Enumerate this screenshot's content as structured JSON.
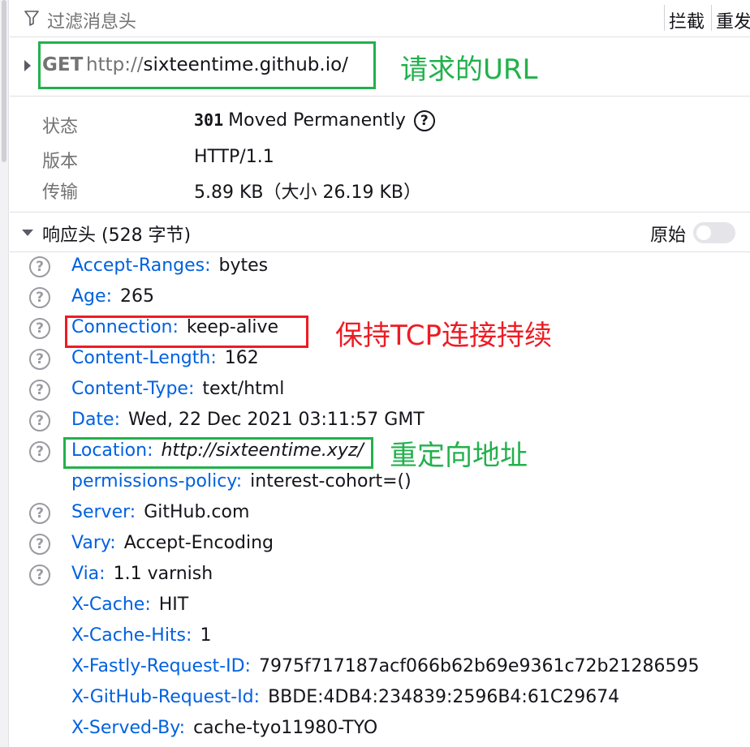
{
  "filter_bar": {
    "placeholder": "过滤消息头",
    "block_label": "拦截",
    "resend_label": "重发"
  },
  "request": {
    "method": "GET",
    "url_scheme": "http://",
    "url_rest": "sixteentime.github.io/"
  },
  "status": {
    "status_label": "状态",
    "status_code": "301",
    "status_text": "Moved Permanently",
    "version_label": "版本",
    "version_value": "HTTP/1.1",
    "transfer_label": "传输",
    "transfer_value": "5.89 KB（大小 26.19 KB）"
  },
  "response_headers": {
    "title": "响应头 (528 字节)",
    "raw_label": "原始",
    "raw_toggle_on": false,
    "help_glyph": "?",
    "rows": [
      {
        "name": "Accept-Ranges",
        "value": "bytes",
        "help": true
      },
      {
        "name": "Age",
        "value": "265",
        "help": true
      },
      {
        "name": "Connection",
        "value": "keep-alive",
        "help": true
      },
      {
        "name": "Content-Length",
        "value": "162",
        "help": true
      },
      {
        "name": "Content-Type",
        "value": "text/html",
        "help": true
      },
      {
        "name": "Date",
        "value": "Wed, 22 Dec 2021 03:11:57 GMT",
        "help": true
      },
      {
        "name": "Location",
        "value": "http://sixteentime.xyz/",
        "help": true,
        "italic": true
      },
      {
        "name": "permissions-policy",
        "value": "interest-cohort=()",
        "help": false
      },
      {
        "name": "Server",
        "value": "GitHub.com",
        "help": true
      },
      {
        "name": "Vary",
        "value": "Accept-Encoding",
        "help": true
      },
      {
        "name": "Via",
        "value": "1.1 varnish",
        "help": true
      },
      {
        "name": "X-Cache",
        "value": "HIT",
        "help": false
      },
      {
        "name": "X-Cache-Hits",
        "value": "1",
        "help": false
      },
      {
        "name": "X-Fastly-Request-ID",
        "value": "7975f717187acf066b62b69e9361c72b21286595",
        "help": false
      },
      {
        "name": "X-GitHub-Request-Id",
        "value": "BBDE:4DB4:234839:2596B4:61C29674",
        "help": false
      },
      {
        "name": "X-Served-By",
        "value": "cache-tyo11980-TYO",
        "help": false
      }
    ]
  },
  "annotations": {
    "url_note": "请求的URL",
    "connection_note": "保持TCP连接持续",
    "location_note": "重定向地址",
    "green_color": "#22b14c",
    "red_color": "#ed1c24"
  },
  "colors": {
    "header_name": "#0061e0",
    "text": "#15141a",
    "muted": "#737373"
  },
  "icons": [
    "filter-icon",
    "expand-arrow-icon",
    "help-icon",
    "toggle-switch"
  ]
}
